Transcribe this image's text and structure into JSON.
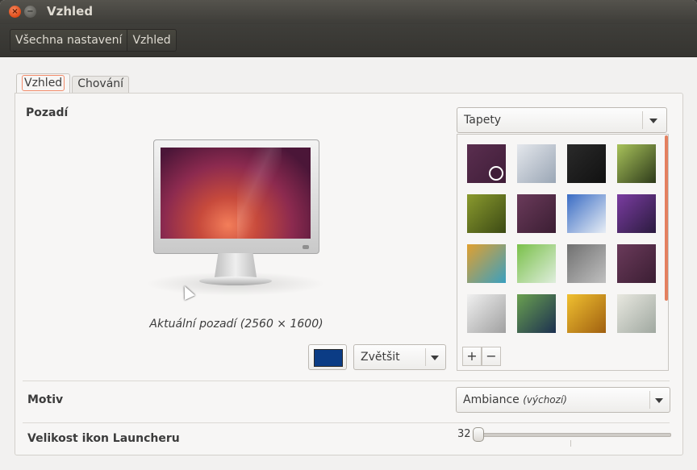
{
  "window": {
    "title": "Vzhled"
  },
  "breadcrumb": [
    "Všechna nastavení",
    "Vzhled"
  ],
  "tabs": [
    {
      "label": "Vzhled",
      "active": true
    },
    {
      "label": "Chování",
      "active": false
    }
  ],
  "background": {
    "section_title": "Pozadí",
    "source_select": "Tapety",
    "caption": "Aktuální pozadí (2560 × 1600)",
    "swatch_color": "#0b3c85",
    "mode_select": "Zvětšit",
    "add_label": "+",
    "remove_label": "−",
    "wallpapers": [
      {
        "name": "wallpaper-1",
        "colors": [
          "#5a2e4f",
          "#3f1d38"
        ],
        "selected": true
      },
      {
        "name": "wallpaper-2",
        "colors": [
          "#e4e7ec",
          "#9aa6b5"
        ]
      },
      {
        "name": "wallpaper-3",
        "colors": [
          "#2a2a2a",
          "#111111"
        ]
      },
      {
        "name": "wallpaper-4",
        "colors": [
          "#a8c25a",
          "#2d3a1a"
        ]
      },
      {
        "name": "wallpaper-5",
        "colors": [
          "#8a9a2e",
          "#3c4a14"
        ]
      },
      {
        "name": "wallpaper-6",
        "colors": [
          "#6a3a5a",
          "#3b1e33"
        ]
      },
      {
        "name": "wallpaper-7",
        "colors": [
          "#3a6cc4",
          "#e8eef5"
        ]
      },
      {
        "name": "wallpaper-8",
        "colors": [
          "#7a3ca0",
          "#2b1b3f"
        ]
      },
      {
        "name": "wallpaper-9",
        "colors": [
          "#e0a030",
          "#3aa0c0"
        ]
      },
      {
        "name": "wallpaper-10",
        "colors": [
          "#7ac04a",
          "#dfeedd"
        ]
      },
      {
        "name": "wallpaper-11",
        "colors": [
          "#707070",
          "#c0c0c0"
        ]
      },
      {
        "name": "wallpaper-12",
        "colors": [
          "#6a3a5a",
          "#3b1e33"
        ]
      },
      {
        "name": "wallpaper-13",
        "colors": [
          "#f0f0f0",
          "#a0a0a0"
        ]
      },
      {
        "name": "wallpaper-14",
        "colors": [
          "#6aa050",
          "#1c3050"
        ]
      },
      {
        "name": "wallpaper-15",
        "colors": [
          "#f0c030",
          "#a06010"
        ]
      },
      {
        "name": "wallpaper-16",
        "colors": [
          "#e8e8e0",
          "#a0a8a0"
        ]
      }
    ]
  },
  "theme": {
    "section_title": "Motiv",
    "select_value": "Ambiance",
    "select_suffix": "(výchozí)"
  },
  "launcher": {
    "section_title": "Velikost ikon Launcheru",
    "icon_size": "32",
    "slider_fraction": 0
  },
  "colors": {
    "accent": "#f28c6b",
    "titlebar": "#3c3b37",
    "close": "#df4a16"
  }
}
